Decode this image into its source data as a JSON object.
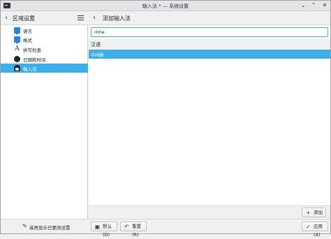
{
  "window": {
    "title": "输入法 * — 系统设置",
    "buttons": {
      "minimize": "⌄",
      "maximize": "⌃",
      "close": "✕"
    }
  },
  "left": {
    "title": "区域设置",
    "items": [
      {
        "label": "语言",
        "icon": "monitor-icon",
        "active": false
      },
      {
        "label": "格式",
        "icon": "monitor-icon",
        "active": false
      },
      {
        "label": "拼写检查",
        "icon": "spellcheck-icon",
        "active": false
      },
      {
        "label": "日期和时间",
        "icon": "clock-icon",
        "active": false
      },
      {
        "label": "输入法",
        "icon": "tux-icon",
        "active": true
      }
    ],
    "footer_label": "高亮显示已更改设置"
  },
  "right": {
    "title": "添加输入法",
    "search_value": "rime",
    "group_label": "汉语",
    "rows": [
      {
        "label": "中州韻",
        "selected": true
      }
    ],
    "add_label": "添加",
    "buttons": {
      "defaults": "默认(D)",
      "reset": "重置(R)",
      "apply": "应用(A)"
    }
  },
  "colors": {
    "accent": "#3daee9",
    "window_bg": "#eff0f1",
    "text": "#232627"
  }
}
